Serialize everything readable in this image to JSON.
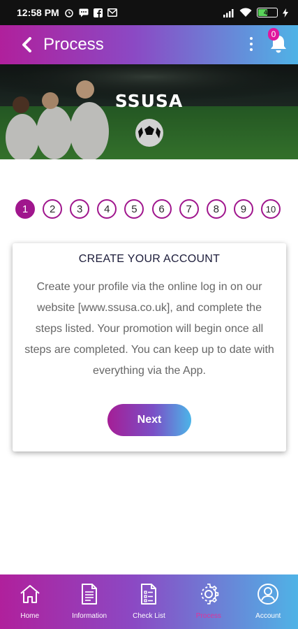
{
  "status_bar": {
    "time": "12:58 PM",
    "battery_level": "47",
    "left_icons": [
      "alarm-icon",
      "message-icon",
      "facebook-icon",
      "gmail-icon"
    ],
    "right_icons": [
      "signal-icon",
      "wifi-icon",
      "battery-icon",
      "charging-icon"
    ]
  },
  "app_bar": {
    "title": "Process",
    "notification_count": "0"
  },
  "banner": {
    "title": "SSUSA"
  },
  "steps": [
    "1",
    "2",
    "3",
    "4",
    "5",
    "6",
    "7",
    "8",
    "9",
    "10"
  ],
  "active_step": "1",
  "card": {
    "title": "CREATE YOUR ACCOUNT",
    "body": "Create your profile via the online log in on our website [www.ssusa.co.uk], and complete the steps listed. Your promotion will begin once all steps are completed. You can keep up to date with everything via the App.",
    "button_label": "Next"
  },
  "bottom_nav": [
    {
      "label": "Home",
      "icon": "home-icon"
    },
    {
      "label": "Information",
      "icon": "document-icon"
    },
    {
      "label": "Check List",
      "icon": "checklist-icon"
    },
    {
      "label": "Process",
      "icon": "gear-icon"
    },
    {
      "label": "Account",
      "icon": "account-icon"
    }
  ],
  "colors": {
    "gradient_start": "#b0209c",
    "gradient_end": "#4fb3e6",
    "accent": "#a0168d"
  }
}
